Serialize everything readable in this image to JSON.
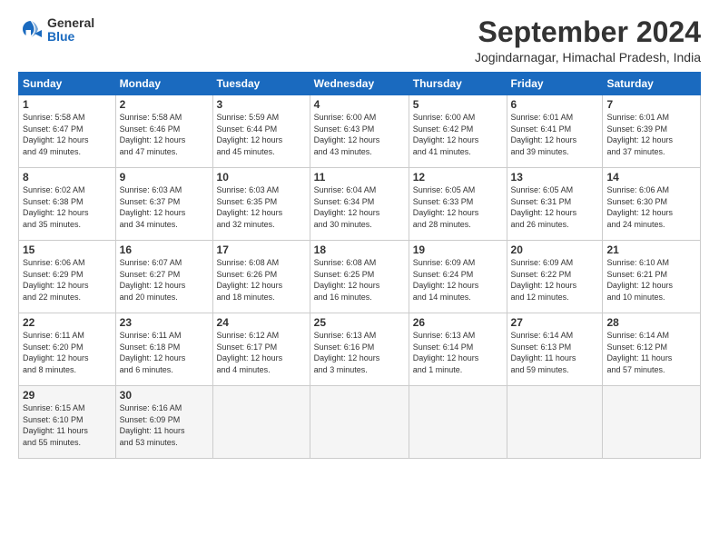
{
  "logo": {
    "general": "General",
    "blue": "Blue"
  },
  "title": "September 2024",
  "subtitle": "Jogindarnagar, Himachal Pradesh, India",
  "headers": [
    "Sunday",
    "Monday",
    "Tuesday",
    "Wednesday",
    "Thursday",
    "Friday",
    "Saturday"
  ],
  "weeks": [
    [
      {
        "day": "1",
        "info": "Sunrise: 5:58 AM\nSunset: 6:47 PM\nDaylight: 12 hours\nand 49 minutes."
      },
      {
        "day": "2",
        "info": "Sunrise: 5:58 AM\nSunset: 6:46 PM\nDaylight: 12 hours\nand 47 minutes."
      },
      {
        "day": "3",
        "info": "Sunrise: 5:59 AM\nSunset: 6:44 PM\nDaylight: 12 hours\nand 45 minutes."
      },
      {
        "day": "4",
        "info": "Sunrise: 6:00 AM\nSunset: 6:43 PM\nDaylight: 12 hours\nand 43 minutes."
      },
      {
        "day": "5",
        "info": "Sunrise: 6:00 AM\nSunset: 6:42 PM\nDaylight: 12 hours\nand 41 minutes."
      },
      {
        "day": "6",
        "info": "Sunrise: 6:01 AM\nSunset: 6:41 PM\nDaylight: 12 hours\nand 39 minutes."
      },
      {
        "day": "7",
        "info": "Sunrise: 6:01 AM\nSunset: 6:39 PM\nDaylight: 12 hours\nand 37 minutes."
      }
    ],
    [
      {
        "day": "8",
        "info": "Sunrise: 6:02 AM\nSunset: 6:38 PM\nDaylight: 12 hours\nand 35 minutes."
      },
      {
        "day": "9",
        "info": "Sunrise: 6:03 AM\nSunset: 6:37 PM\nDaylight: 12 hours\nand 34 minutes."
      },
      {
        "day": "10",
        "info": "Sunrise: 6:03 AM\nSunset: 6:35 PM\nDaylight: 12 hours\nand 32 minutes."
      },
      {
        "day": "11",
        "info": "Sunrise: 6:04 AM\nSunset: 6:34 PM\nDaylight: 12 hours\nand 30 minutes."
      },
      {
        "day": "12",
        "info": "Sunrise: 6:05 AM\nSunset: 6:33 PM\nDaylight: 12 hours\nand 28 minutes."
      },
      {
        "day": "13",
        "info": "Sunrise: 6:05 AM\nSunset: 6:31 PM\nDaylight: 12 hours\nand 26 minutes."
      },
      {
        "day": "14",
        "info": "Sunrise: 6:06 AM\nSunset: 6:30 PM\nDaylight: 12 hours\nand 24 minutes."
      }
    ],
    [
      {
        "day": "15",
        "info": "Sunrise: 6:06 AM\nSunset: 6:29 PM\nDaylight: 12 hours\nand 22 minutes."
      },
      {
        "day": "16",
        "info": "Sunrise: 6:07 AM\nSunset: 6:27 PM\nDaylight: 12 hours\nand 20 minutes."
      },
      {
        "day": "17",
        "info": "Sunrise: 6:08 AM\nSunset: 6:26 PM\nDaylight: 12 hours\nand 18 minutes."
      },
      {
        "day": "18",
        "info": "Sunrise: 6:08 AM\nSunset: 6:25 PM\nDaylight: 12 hours\nand 16 minutes."
      },
      {
        "day": "19",
        "info": "Sunrise: 6:09 AM\nSunset: 6:24 PM\nDaylight: 12 hours\nand 14 minutes."
      },
      {
        "day": "20",
        "info": "Sunrise: 6:09 AM\nSunset: 6:22 PM\nDaylight: 12 hours\nand 12 minutes."
      },
      {
        "day": "21",
        "info": "Sunrise: 6:10 AM\nSunset: 6:21 PM\nDaylight: 12 hours\nand 10 minutes."
      }
    ],
    [
      {
        "day": "22",
        "info": "Sunrise: 6:11 AM\nSunset: 6:20 PM\nDaylight: 12 hours\nand 8 minutes."
      },
      {
        "day": "23",
        "info": "Sunrise: 6:11 AM\nSunset: 6:18 PM\nDaylight: 12 hours\nand 6 minutes."
      },
      {
        "day": "24",
        "info": "Sunrise: 6:12 AM\nSunset: 6:17 PM\nDaylight: 12 hours\nand 4 minutes."
      },
      {
        "day": "25",
        "info": "Sunrise: 6:13 AM\nSunset: 6:16 PM\nDaylight: 12 hours\nand 3 minutes."
      },
      {
        "day": "26",
        "info": "Sunrise: 6:13 AM\nSunset: 6:14 PM\nDaylight: 12 hours\nand 1 minute."
      },
      {
        "day": "27",
        "info": "Sunrise: 6:14 AM\nSunset: 6:13 PM\nDaylight: 11 hours\nand 59 minutes."
      },
      {
        "day": "28",
        "info": "Sunrise: 6:14 AM\nSunset: 6:12 PM\nDaylight: 11 hours\nand 57 minutes."
      }
    ],
    [
      {
        "day": "29",
        "info": "Sunrise: 6:15 AM\nSunset: 6:10 PM\nDaylight: 11 hours\nand 55 minutes."
      },
      {
        "day": "30",
        "info": "Sunrise: 6:16 AM\nSunset: 6:09 PM\nDaylight: 11 hours\nand 53 minutes."
      },
      {
        "day": "",
        "info": ""
      },
      {
        "day": "",
        "info": ""
      },
      {
        "day": "",
        "info": ""
      },
      {
        "day": "",
        "info": ""
      },
      {
        "day": "",
        "info": ""
      }
    ]
  ]
}
